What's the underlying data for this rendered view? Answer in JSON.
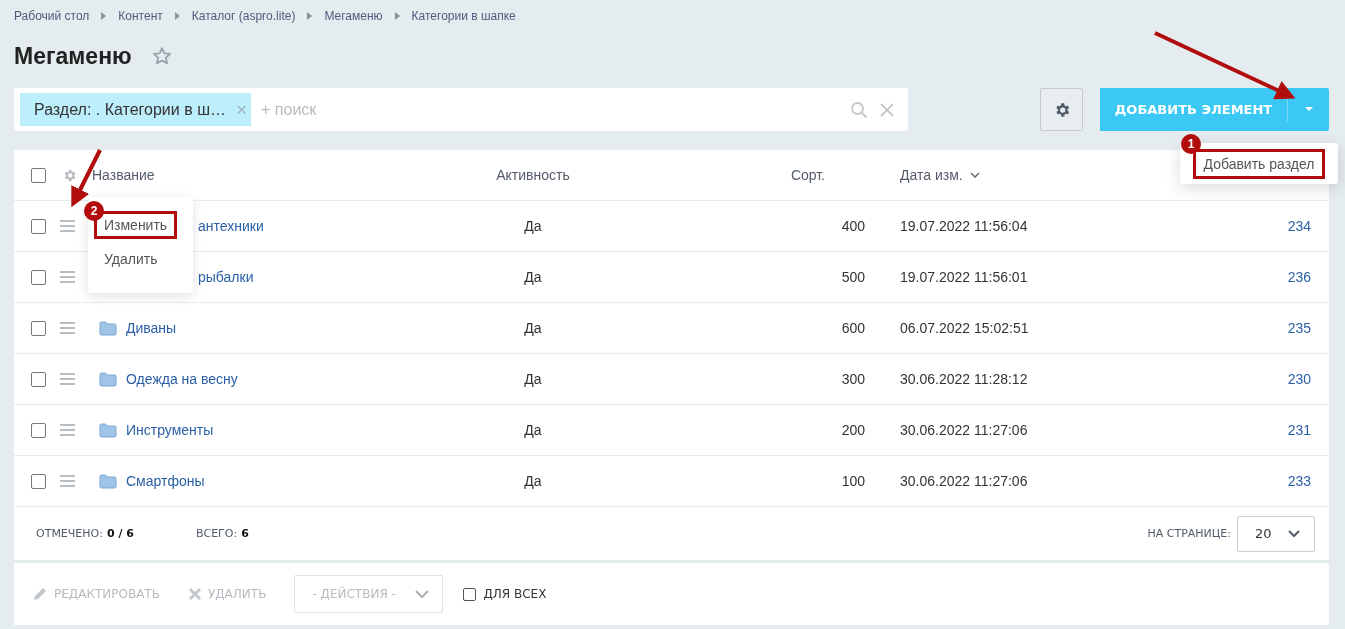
{
  "breadcrumbs": [
    "Рабочий стол",
    "Контент",
    "Каталог (aspro.lite)",
    "Мегаменю",
    "Категории в шапке"
  ],
  "title": "Мегаменю",
  "filter": {
    "tag": "Раздел: . Категории в ш…",
    "tag_close": "×",
    "placeholder": "+ поиск"
  },
  "add_button": {
    "label": "ДОБАВИТЬ ЭЛЕМЕНТ",
    "menu": [
      "Добавить раздел"
    ]
  },
  "table": {
    "all_checked": false,
    "columns": [
      "Название",
      "Активность",
      "Сорт.",
      "Дата изм."
    ],
    "rows": [
      {
        "kind": "covered",
        "name": "антехники",
        "active": "Да",
        "sort": "400",
        "date": "19.07.2022 11:56:04",
        "id": "234",
        "checked": false
      },
      {
        "kind": "covered",
        "name": "рыбалки",
        "active": "Да",
        "sort": "500",
        "date": "19.07.2022 11:56:01",
        "id": "236",
        "checked": false
      },
      {
        "kind": "folder",
        "name": "Диваны",
        "active": "Да",
        "sort": "600",
        "date": "06.07.2022 15:02:51",
        "id": "235",
        "checked": false
      },
      {
        "kind": "folder",
        "name": "Одежда на весну",
        "active": "Да",
        "sort": "300",
        "date": "30.06.2022 11:28:12",
        "id": "230",
        "checked": false
      },
      {
        "kind": "folder",
        "name": "Инструменты",
        "active": "Да",
        "sort": "200",
        "date": "30.06.2022 11:27:06",
        "id": "231",
        "checked": false
      },
      {
        "kind": "folder",
        "name": "Смартфоны",
        "active": "Да",
        "sort": "100",
        "date": "30.06.2022 11:27:06",
        "id": "233",
        "checked": false
      }
    ],
    "row_menu": [
      "Изменить",
      "Удалить"
    ]
  },
  "footer": {
    "checked_label": "ОТМЕЧЕНО:",
    "checked_value": "0 / 6",
    "total_label": "ВСЕГО:",
    "total_value": "6",
    "per_page_label": "НА СТРАНИЦЕ:",
    "per_page": "20"
  },
  "actions": {
    "edit": "РЕДАКТИРОВАТЬ",
    "delete": "УДАЛИТЬ",
    "select": "- ДЕЙСТВИЯ -",
    "for_all": "ДЛЯ ВСЕХ",
    "for_all_checked": false
  },
  "annotations": [
    "1",
    "2"
  ]
}
